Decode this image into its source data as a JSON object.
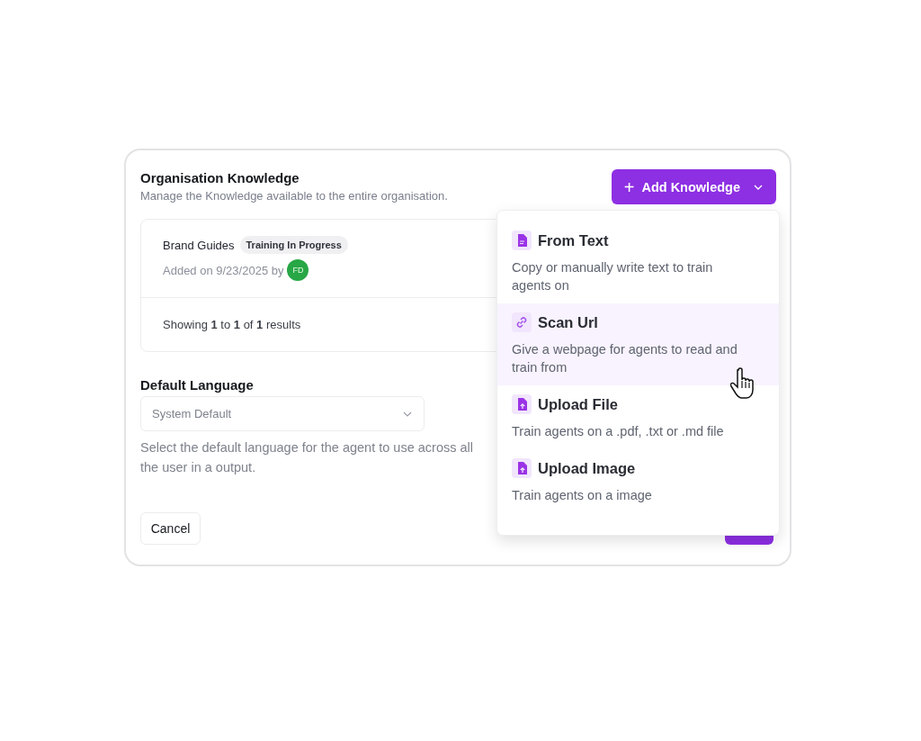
{
  "header": {
    "title": "Organisation Knowledge",
    "subtitle": "Manage the Knowledge available to the entire organisation.",
    "add_button": "Add Knowledge",
    "add_icon": "+"
  },
  "knowledge_items": [
    {
      "name": "Brand Guides",
      "status": "Training In Progress",
      "added": "Added on 9/23/2025 by",
      "avatar": "FD",
      "color": "#27a745"
    }
  ],
  "pagination": "Showing **1** to **1** of **1** results",
  "default_language": {
    "label": "Default Language",
    "value": "System Default",
    "help_lines": [
      "Select the default language for the agent to use across all",
      "the user in a output."
    ]
  },
  "buttons": {
    "cancel": "Cancel"
  },
  "menu": [
    {
      "kind": "text",
      "title": "From Text",
      "description": "Copy or manually write text to train agents on",
      "selected": false
    },
    {
      "kind": "link",
      "title": "Scan Url",
      "description": "Give a webpage for agents to read and train from",
      "selected": true
    },
    {
      "kind": "upload",
      "title": "Upload File",
      "description": "Train agents on a .pdf, .txt or .md file",
      "selected": false
    },
    {
      "kind": "upload",
      "title": "Upload Image",
      "description": "Train agents on a image",
      "selected": false
    }
  ]
}
